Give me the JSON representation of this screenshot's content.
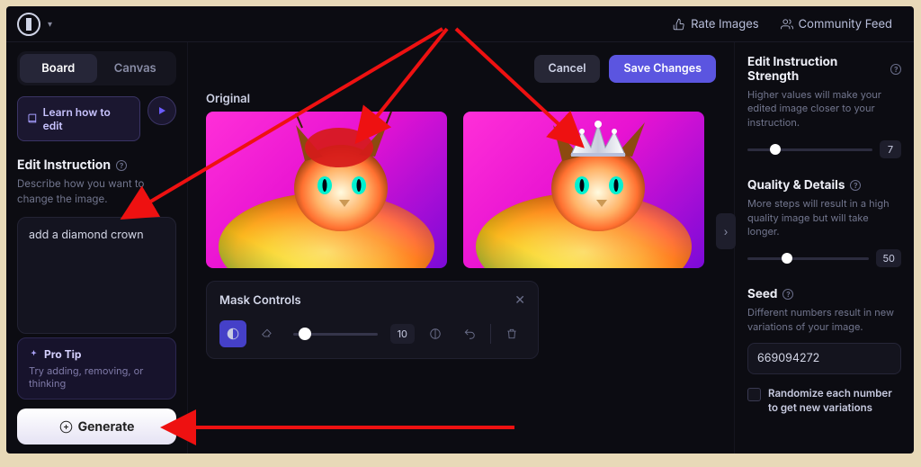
{
  "topbar": {
    "rate_images": "Rate Images",
    "community_feed": "Community Feed"
  },
  "sidebar": {
    "tabs": {
      "board": "Board",
      "canvas": "Canvas"
    },
    "learn_label": "Learn how to edit",
    "edit_instruction_title": "Edit Instruction",
    "edit_instruction_desc": "Describe how you want to change the image.",
    "prompt_value": "add a diamond crown",
    "protip_title": "Pro Tip",
    "protip_desc": "Try adding, removing, or thinking",
    "generate_label": "Generate"
  },
  "center": {
    "cancel_label": "Cancel",
    "save_label": "Save Changes",
    "original_label": "Original",
    "mask_title": "Mask Controls",
    "mask_slider_value": "10"
  },
  "rightbar": {
    "strength_title": "Edit Instruction Strength",
    "strength_desc": "Higher values will make your edited image closer to your instruction.",
    "strength_value": "7",
    "quality_title": "Quality & Details",
    "quality_desc": "More steps will result in a high quality image but will take longer.",
    "quality_value": "50",
    "seed_title": "Seed",
    "seed_desc": "Different numbers result in new variations of your image.",
    "seed_value": "669094272",
    "randomize_label": "Randomize each number to get new variations"
  }
}
